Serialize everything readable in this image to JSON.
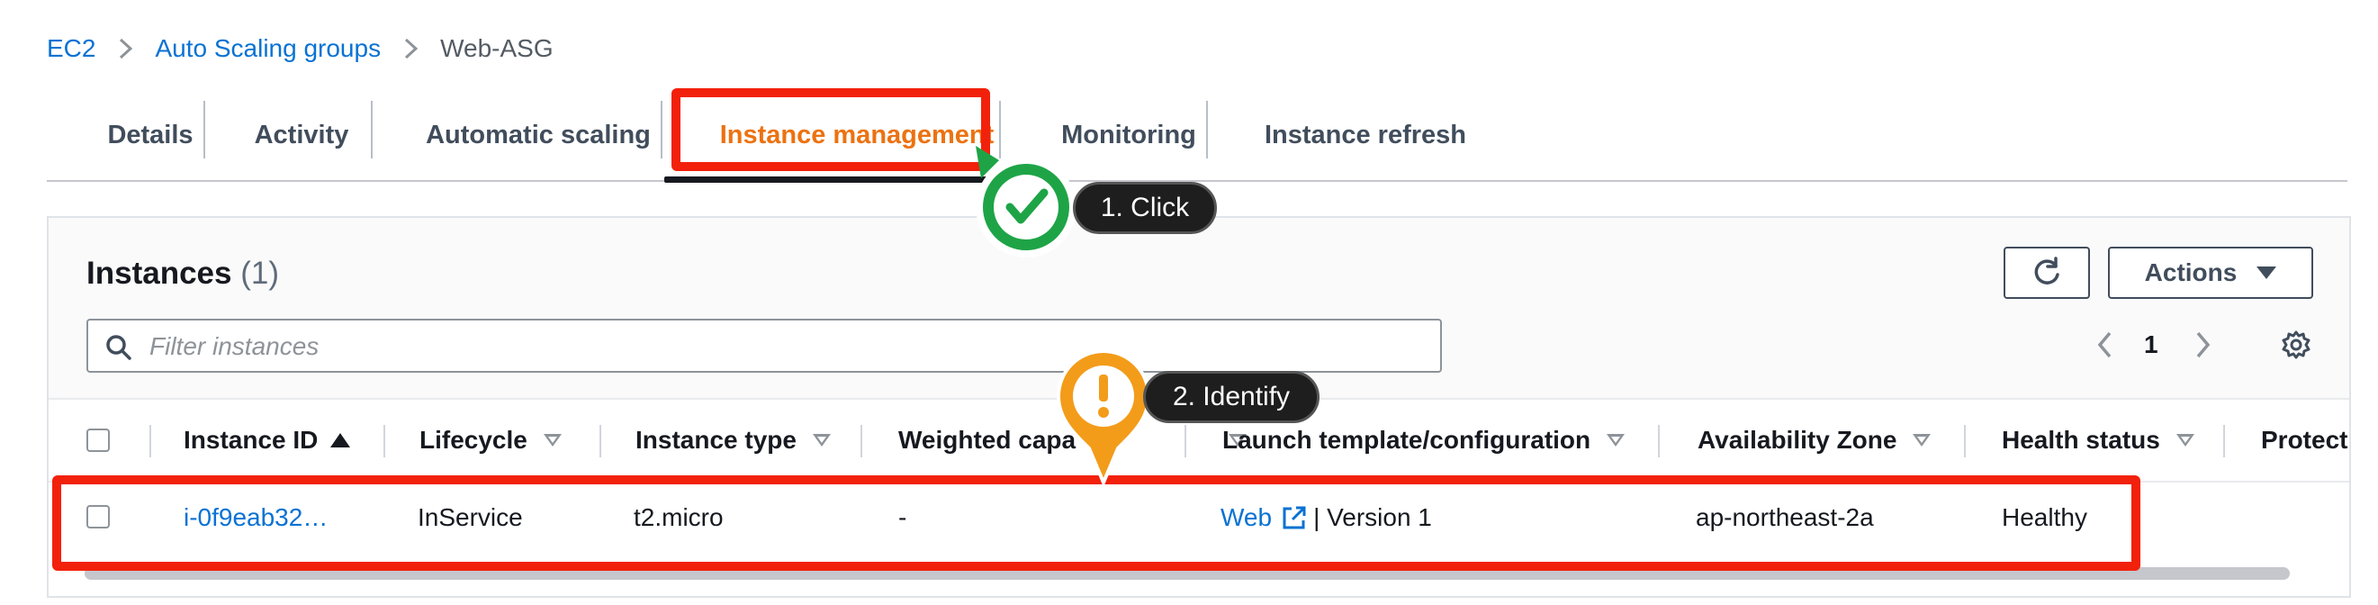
{
  "breadcrumb": {
    "items": [
      {
        "label": "EC2"
      },
      {
        "label": "Auto Scaling groups"
      },
      {
        "label": "Web-ASG"
      }
    ]
  },
  "tabs": [
    {
      "label": "Details"
    },
    {
      "label": "Activity"
    },
    {
      "label": "Automatic scaling"
    },
    {
      "label": "Instance management",
      "active": true
    },
    {
      "label": "Monitoring"
    },
    {
      "label": "Instance refresh"
    }
  ],
  "instances": {
    "title": "Instances",
    "count": "(1)",
    "actions_label": "Actions",
    "filter_placeholder": "Filter instances",
    "page": "1"
  },
  "table": {
    "columns": [
      {
        "label": "Instance ID"
      },
      {
        "label": "Lifecycle"
      },
      {
        "label": "Instance type"
      },
      {
        "label": "Weighted capa"
      },
      {
        "label": "Launch template/configuration"
      },
      {
        "label": "Availability Zone"
      },
      {
        "label": "Health status"
      },
      {
        "label": "Protect"
      }
    ],
    "rows": [
      {
        "instance_id": "i-0f9eab32…",
        "lifecycle": "InService",
        "instance_type": "t2.micro",
        "weighted_capacity": "-",
        "launch_template_link": "Web",
        "launch_template_version": "| Version 1",
        "availability_zone": "ap-northeast-2a",
        "health_status": "Healthy"
      }
    ]
  },
  "annotations": {
    "step1": "1. Click",
    "step2": "2. Identify"
  },
  "colors": {
    "accent_orange": "#ec7211",
    "link_blue": "#0972d3",
    "highlight_red": "#f2210b",
    "badge_green": "#1ea446",
    "badge_orange": "#f39c1a"
  }
}
